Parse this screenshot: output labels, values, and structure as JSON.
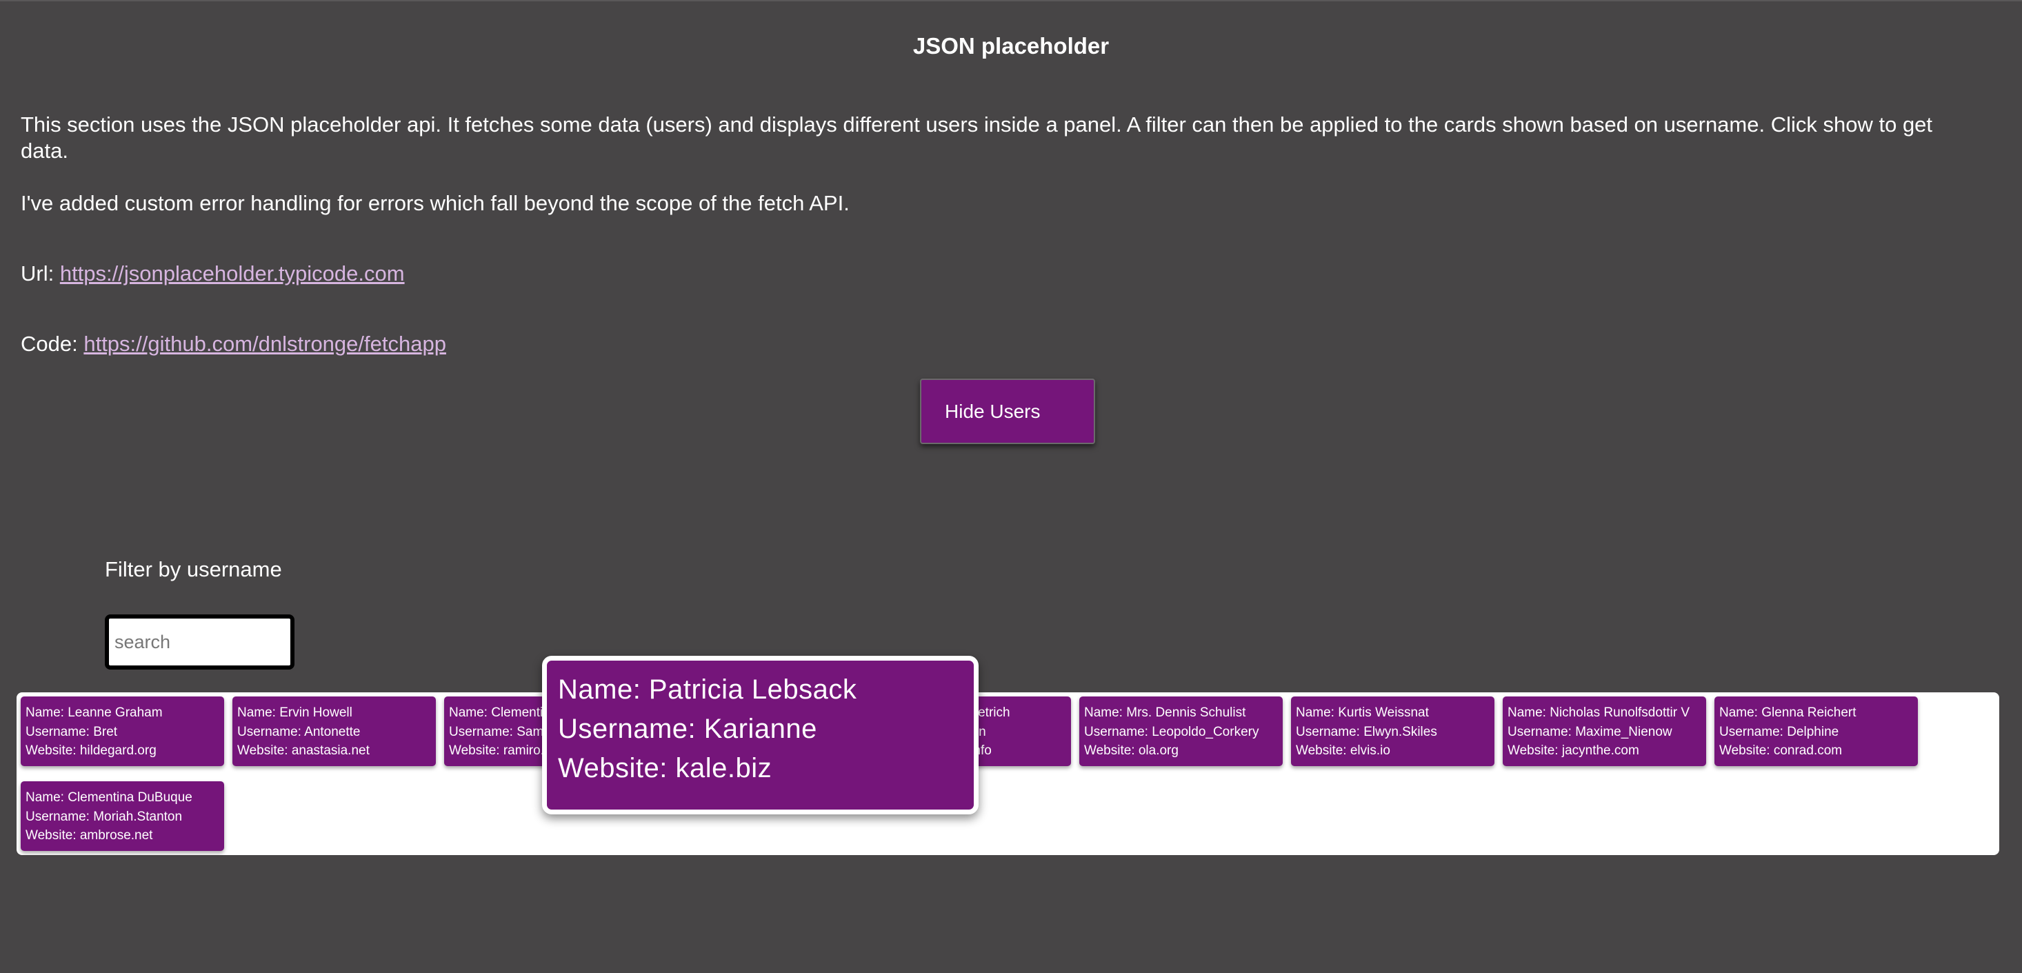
{
  "page": {
    "title": "JSON placeholder",
    "intro": "This section uses the JSON placeholder api. It fetches some data (users) and displays different users inside a panel. A filter can then be applied to the cards shown based on username. Click show to get data.",
    "error_note": "I've added custom error handling for errors which fall beyond the scope of the fetch API.",
    "url_label": "Url: ",
    "url_link": "https://jsonplaceholder.typicode.com",
    "code_label": "Code: ",
    "code_link": "https://github.com/dnlstronge/fetchapp"
  },
  "controls": {
    "hide_button": "Hide Users",
    "filter_label": "Filter by username",
    "search_placeholder": "search",
    "search_value": ""
  },
  "cards": [
    {
      "name": "Name: Leanne Graham",
      "username": "Username: Bret",
      "website": "Website: hildegard.org"
    },
    {
      "name": "Name: Ervin Howell",
      "username": "Username: Antonette",
      "website": "Website: anastasia.net"
    },
    {
      "name": "Name: Clementine Bauch",
      "username": "Username: Samantha",
      "website": "Website: ramiro.info"
    },
    {
      "name": "",
      "username": "",
      "website": ""
    },
    {
      "name": "Name: Chelsey Dietrich",
      "username": "Username: Kamren",
      "website": "Website: conrad.info"
    },
    {
      "name": "Name: Mrs. Dennis Schulist",
      "username": "Username: Leopoldo_Corkery",
      "website": "Website: ola.org"
    },
    {
      "name": "Name: Kurtis Weissnat",
      "username": "Username: Elwyn.Skiles",
      "website": "Website: elvis.io"
    },
    {
      "name": "Name: Nicholas Runolfsdottir V",
      "username": "Username: Maxime_Nienow",
      "website": "Website: jacynthe.com"
    },
    {
      "name": "Name: Glenna Reichert",
      "username": "Username: Delphine",
      "website": "Website: conrad.com"
    },
    {
      "name": "Name: Clementina DuBuque",
      "username": "Username: Moriah.Stanton",
      "website": "Website: ambrose.net"
    }
  ],
  "hovered_card": {
    "name": "Name: Patricia Lebsack",
    "username": "Username: Karianne",
    "website": "Website: kale.biz"
  },
  "colors": {
    "background": "#474546",
    "card": "#75157a",
    "link": "#d7b5e0",
    "panel": "#ffffff"
  }
}
